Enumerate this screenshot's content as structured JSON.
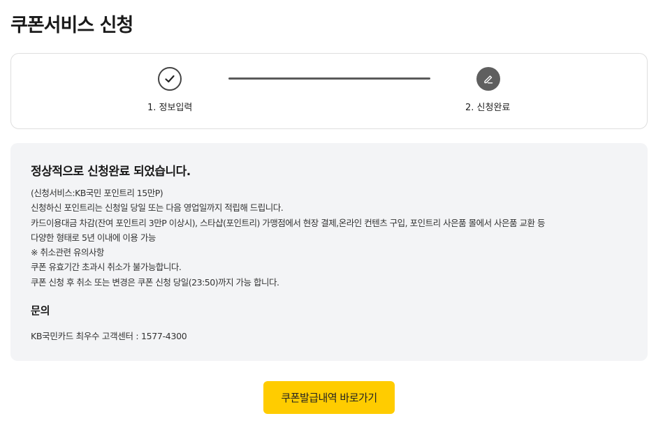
{
  "page": {
    "title": "쿠폰서비스 신청"
  },
  "stepper": {
    "steps": [
      {
        "label": "1. 정보입력",
        "state": "done",
        "icon": "check-icon"
      },
      {
        "label": "2. 신청완료",
        "state": "active",
        "icon": "pencil-icon"
      }
    ]
  },
  "info": {
    "headline": "정상적으로 신청완료 되었습니다.",
    "lines": [
      "(신청서비스:KB국민 포인트리 15만P)",
      "신청하신 포인트리는 신청일 당일 또는 다음 영업일까지 적립해 드립니다.",
      "카드이용대금 차감(잔여 포인트리 3만P 이상시), 스타샵(포인트리) 가맹점에서 현장 결제,온라인 컨텐츠 구입, 포인트리 사은품 몰에서 사은품 교환 등",
      "다양한 형태로 5년 이내에 이용 가능",
      "※ 취소관련 유의사항",
      "쿠폰 유효기간 초과시 취소가 불가능합니다.",
      "쿠폰 신청 후 취소 또는 변경은 쿠폰 신청 당일(23:50)까지 가능 합니다."
    ]
  },
  "contact": {
    "title": "문의",
    "text": "KB국민카드 최우수 고객센터 : 1577-4300"
  },
  "cta": {
    "label": "쿠폰발급내역 바로가기"
  },
  "colors": {
    "accent": "#ffcc00",
    "info_bg": "#f3f4f6",
    "step_active": "#5f5f5f"
  }
}
